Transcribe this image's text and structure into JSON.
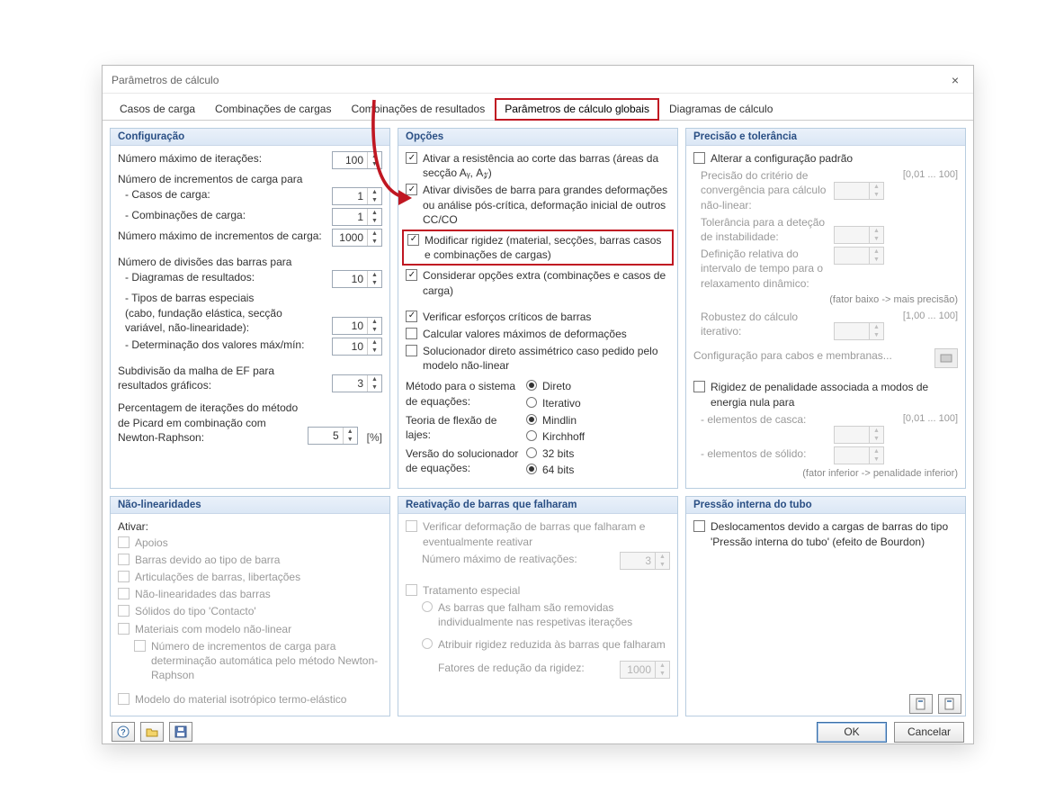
{
  "title": "Parâmetros de cálculo",
  "close": "×",
  "tabs": {
    "t0": "Casos de carga",
    "t1": "Combinações de cargas",
    "t2": "Combinações de resultados",
    "t3": "Parâmetros de cálculo globais",
    "t4": "Diagramas de cálculo"
  },
  "config": {
    "title": "Configuração",
    "max_iter_lbl": "Número máximo de iterações:",
    "max_iter": "100",
    "incr_para_lbl": "Número de incrementos de carga para",
    "casos_lbl": "- Casos de carga:",
    "casos": "1",
    "comb_lbl": "- Combinações de carga:",
    "comb": "1",
    "max_incr_lbl": "Número máximo de incrementos de carga:",
    "max_incr": "1000",
    "div_barras_lbl": "Número de divisões das barras para",
    "diag_res_lbl": "- Diagramas de resultados:",
    "diag_res": "10",
    "tipos_lbl": "- Tipos de barras especiais\n   (cabo, fundação elástica, secção\n   variável, não-linearidade):",
    "tipos": "10",
    "det_valores_lbl": "- Determinação dos valores máx/mín:",
    "det_valores": "10",
    "subdiv_lbl": "Subdivisão da malha de EF para resultados gráficos:",
    "subdiv": "3",
    "perc_lbl": "Percentagem de iterações do método de Picard em combinação com Newton-Raphson:",
    "perc": "5",
    "perc_unit": "[%]"
  },
  "options": {
    "title": "Opções",
    "o1": "Ativar a resistência ao corte das barras (áreas da secção Aᵧ, A𝓏)",
    "o2": "Ativar divisões de barra para grandes deformações ou análise pós-crítica, deformação inicial de outros CC/CO",
    "o3": "Modificar rigidez (material, secções, barras casos e combinações de cargas)",
    "o4": "Considerar opções extra (combinações e casos de carga)",
    "o5": "Verificar esforços críticos de barras",
    "o6": "Calcular valores máximos de deformações",
    "o7": "Solucionador direto assimétrico caso pedido pelo modelo não-linear",
    "met_lbl": "Método para o sistema de equações:",
    "met_a": "Direto",
    "met_b": "Iterativo",
    "flex_lbl": "Teoria de flexão de lajes:",
    "flex_a": "Mindlin",
    "flex_b": "Kirchhoff",
    "ver_lbl": "Versão do solucionador de equações:",
    "ver_a": "32 bits",
    "ver_b": "64 bits"
  },
  "prec": {
    "title": "Precisão e tolerância",
    "alt": "Alterar a configuração padrão",
    "p1_lbl": "Precisão do critério de convergência para cálculo não-linear:",
    "p1_hint": "[0,01 ... 100]",
    "p2_lbl": "Tolerância para a deteção de instabilidade:",
    "p3_lbl": "Definição relativa do intervalo de tempo para o relaxamento dinâmico:",
    "p3_note": "(fator baixo -> mais precisão)",
    "rob_lbl": "Robustez do cálculo iterativo:",
    "rob_hint": "[1,00 ... 100]",
    "cabos": "Configuração para cabos e membranas...",
    "rig_lbl": "Rigidez de penalidade associada a modos de energia nula para",
    "elc_lbl": "- elementos de casca:",
    "elc_hint": "[0,01 ... 100]",
    "els_lbl": "- elementos de sólido:",
    "rig_note": "(fator inferior -> penalidade inferior)"
  },
  "nonlin": {
    "title": "Não-linearidades",
    "ativ": "Ativar:",
    "a1": "Apoios",
    "a2": "Barras devido ao tipo de barra",
    "a3": "Articulações de barras, libertações",
    "a4": "Não-linearidades das barras",
    "a5": "Sólidos do tipo 'Contacto'",
    "a6": "Materiais com modelo não-linear",
    "a6_sub": "Número de incrementos de carga para determinação automática pelo método Newton-Raphson",
    "a7": "Modelo do material isotrópico termo-elástico"
  },
  "reativ": {
    "title": "Reativação de barras que falharam",
    "r1": "Verificar deformação de barras que falharam e eventualmente reativar",
    "r1_num_lbl": "Número máximo de reativações:",
    "r1_num": "3",
    "r2": "Tratamento especial",
    "r2a": "As barras que falham são removidas individualmente nas respetivas iterações",
    "r2b": "Atribuir rigidez reduzida às barras que falharam",
    "fat_lbl": "Fatores de redução da rigidez:",
    "fat": "1000"
  },
  "tubo": {
    "title": "Pressão interna do tubo",
    "t1": "Deslocamentos devido a cargas de barras do tipo 'Pressão interna do tubo' (efeito de Bourdon)"
  },
  "footer": {
    "ok": "OK",
    "cancel": "Cancelar"
  }
}
